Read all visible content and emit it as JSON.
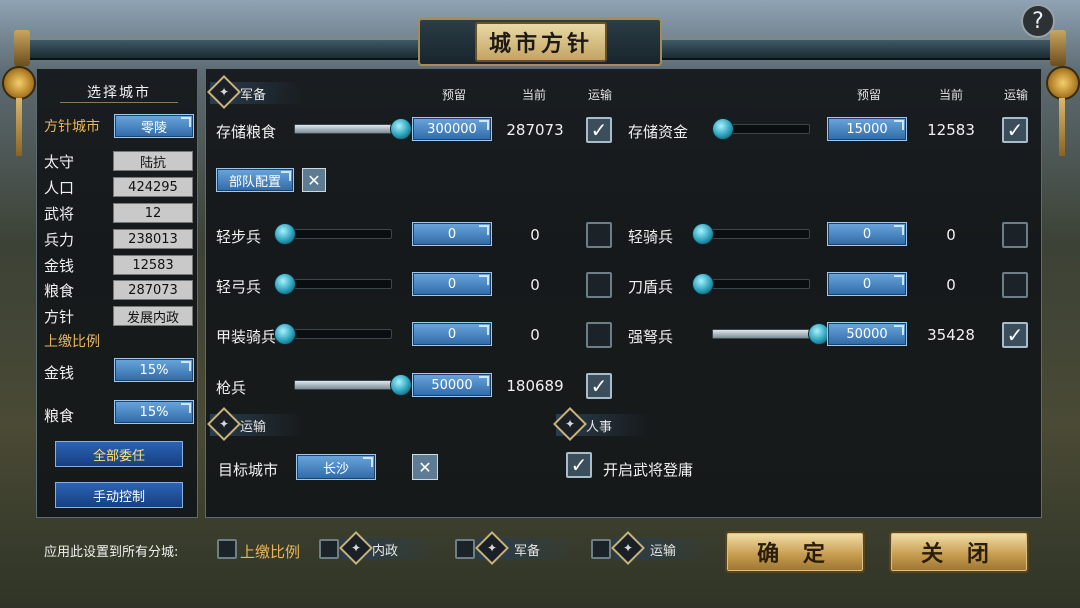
{
  "window": {
    "title": "城市方针",
    "help": "?"
  },
  "left": {
    "header": "选择城市",
    "city_label": "方针城市",
    "city_value": "零陵",
    "stats": [
      {
        "label": "太守",
        "value": "陆抗"
      },
      {
        "label": "人口",
        "value": "424295"
      },
      {
        "label": "武将",
        "value": "12"
      },
      {
        "label": "兵力",
        "value": "238013"
      },
      {
        "label": "金钱",
        "value": "12583"
      },
      {
        "label": "粮食",
        "value": "287073"
      },
      {
        "label": "方针",
        "value": "发展内政"
      }
    ],
    "ratio_header": "上缴比例",
    "ratio_gold_label": "金钱",
    "ratio_gold_value": "15%",
    "ratio_food_label": "粮食",
    "ratio_food_value": "15%",
    "delegate_all": "全部委任",
    "manual": "手动控制"
  },
  "columns": {
    "reserve": "预留",
    "current": "当前",
    "transport": "运输"
  },
  "military": {
    "section": "军备",
    "store_food": {
      "label": "存储粮食",
      "reserve": "300000",
      "current": "287073",
      "transport": true,
      "level": 1.0
    },
    "store_gold": {
      "label": "存储资金",
      "reserve": "15000",
      "current": "12583",
      "transport": true,
      "level": 0.08
    },
    "troop_config": "部队配置",
    "troop_config_close": "✕"
  },
  "troops": [
    {
      "label": "轻步兵",
      "reserve": "0",
      "current": "0",
      "transport": false,
      "level": 0
    },
    {
      "label": "轻骑兵",
      "reserve": "0",
      "current": "0",
      "transport": false,
      "level": 0
    },
    {
      "label": "轻弓兵",
      "reserve": "0",
      "current": "0",
      "transport": false,
      "level": 0
    },
    {
      "label": "刀盾兵",
      "reserve": "0",
      "current": "0",
      "transport": false,
      "level": 0
    },
    {
      "label": "甲装骑兵",
      "reserve": "0",
      "current": "0",
      "transport": false,
      "level": 0
    },
    {
      "label": "强弩兵",
      "reserve": "50000",
      "current": "35428",
      "transport": true,
      "level": 1.0
    },
    {
      "label": "枪兵",
      "reserve": "50000",
      "current": "180689",
      "transport": true,
      "level": 1.0
    }
  ],
  "transport": {
    "section": "运输",
    "target_label": "目标城市",
    "target_value": "长沙",
    "clear": "✕"
  },
  "personnel": {
    "section": "人事",
    "enable_label": "开启武将登庸",
    "enabled": true
  },
  "footer": {
    "apply_label": "应用此设置到所有分城:",
    "opt_ratio": "上缴比例",
    "opt_civil": "内政",
    "opt_military": "军备",
    "opt_transport": "运输",
    "confirm": "确 定",
    "close": "关 闭"
  },
  "icons": {
    "check": "✓",
    "close": "✕",
    "section": "diamond-emblem-icon",
    "orb": "gold-orb-icon"
  }
}
